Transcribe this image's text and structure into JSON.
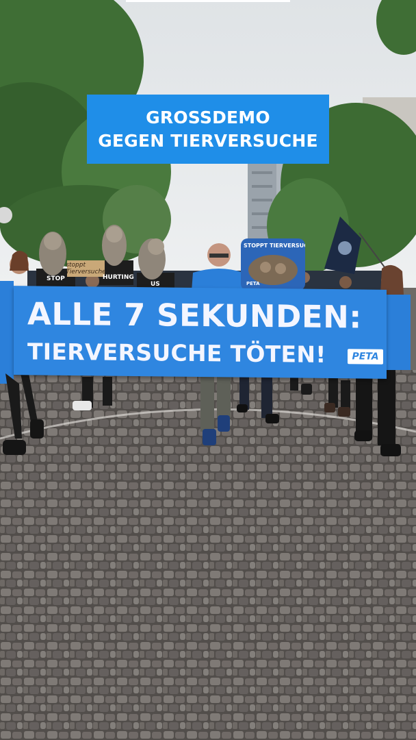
{
  "overlay": {
    "progress": 1.0,
    "title_lines": [
      "GROSSDEMO",
      "GEGEN TIERVERSUCHE"
    ]
  },
  "banner": {
    "line1": "ALLE 7 SEKUNDEN:",
    "line2": "TIERVERSUCHE TÖTEN!",
    "logo": "PETA",
    "color": "#2f86e0"
  },
  "signs": {
    "stop": "STOP",
    "hurting": "HURTING",
    "us": "US",
    "small_sign": "stoppt Tierversuche",
    "round_sign": "STOPPT TIERVERSUCHE",
    "round_sign_logo": "PETA"
  },
  "colors": {
    "title_bg": "#1f8ee8",
    "title_text": "#ffffff",
    "shirt_blue": "#2b7fd9"
  }
}
